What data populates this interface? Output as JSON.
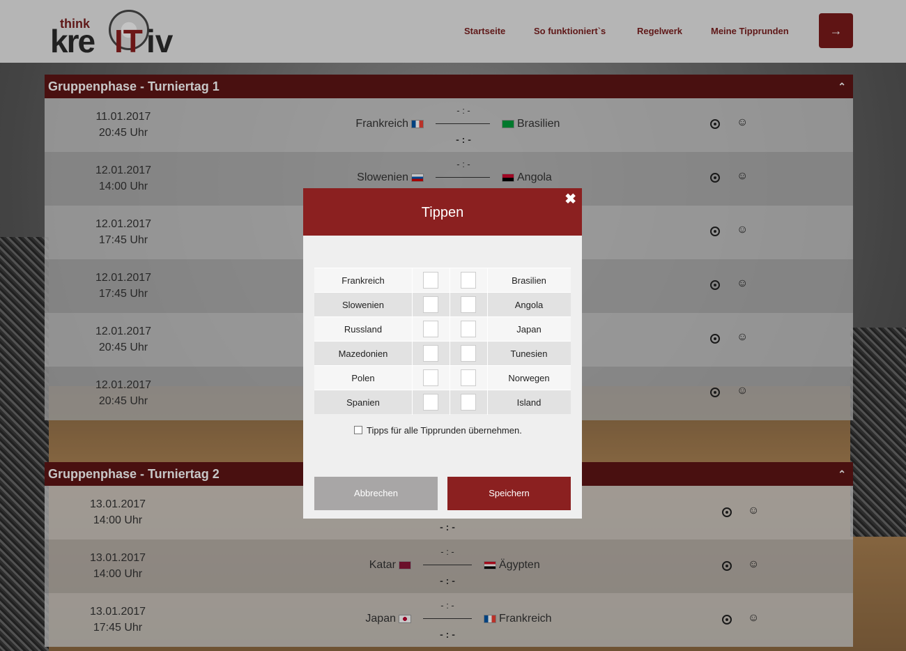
{
  "header": {
    "logo_think": "think",
    "logo_kre": "kre",
    "logo_it": "IT",
    "logo_iv": "iv",
    "nav": [
      "Startseite",
      "So funktioniert`s",
      "Regelwerk",
      "Meine Tipprunden"
    ],
    "logout_icon": "sign-out-icon"
  },
  "sections": [
    {
      "title": "Gruppenphase - Turniertag 1",
      "matches": [
        {
          "date": "11.01.2017",
          "time": "20:45 Uhr",
          "home": "Frankreich",
          "away": "Brasilien",
          "tip": "- : -",
          "result": "- : -"
        },
        {
          "date": "12.01.2017",
          "time": "14:00 Uhr",
          "home": "Slowenien",
          "away": "Angola",
          "tip": "- : -",
          "result": ""
        },
        {
          "date": "12.01.2017",
          "time": "17:45 Uhr"
        },
        {
          "date": "12.01.2017",
          "time": "17:45 Uhr"
        },
        {
          "date": "12.01.2017",
          "time": "20:45 Uhr"
        },
        {
          "date": "12.01.2017",
          "time": "20:45 Uhr"
        }
      ]
    },
    {
      "title": "Gruppenphase - Turniertag 2",
      "matches": [
        {
          "date": "13.01.2017",
          "time": "14:00 Uhr",
          "result": "- : -"
        },
        {
          "date": "13.01.2017",
          "time": "14:00 Uhr",
          "home": "Katar",
          "away": "Ägypten",
          "tip": "- : -",
          "result": "- : -"
        },
        {
          "date": "13.01.2017",
          "time": "17:45 Uhr",
          "home": "Japan",
          "away": "Frankreich",
          "tip": "- : -",
          "result": "- : -"
        }
      ]
    }
  ],
  "modal": {
    "title": "Tippen",
    "close_icon": "close-icon",
    "rows": [
      {
        "home": "Frankreich",
        "away": "Brasilien"
      },
      {
        "home": "Slowenien",
        "away": "Angola"
      },
      {
        "home": "Russland",
        "away": "Japan"
      },
      {
        "home": "Mazedonien",
        "away": "Tunesien"
      },
      {
        "home": "Polen",
        "away": "Norwegen"
      },
      {
        "home": "Spanien",
        "away": "Island"
      }
    ],
    "checkbox_label": "Tipps für alle Tipprunden übernehmen.",
    "cancel_label": "Abbrechen",
    "save_label": "Speichern"
  },
  "colors": {
    "brand": "#8b2020",
    "section_header": "#5e1515",
    "nav_text": "#7a1f1f"
  }
}
